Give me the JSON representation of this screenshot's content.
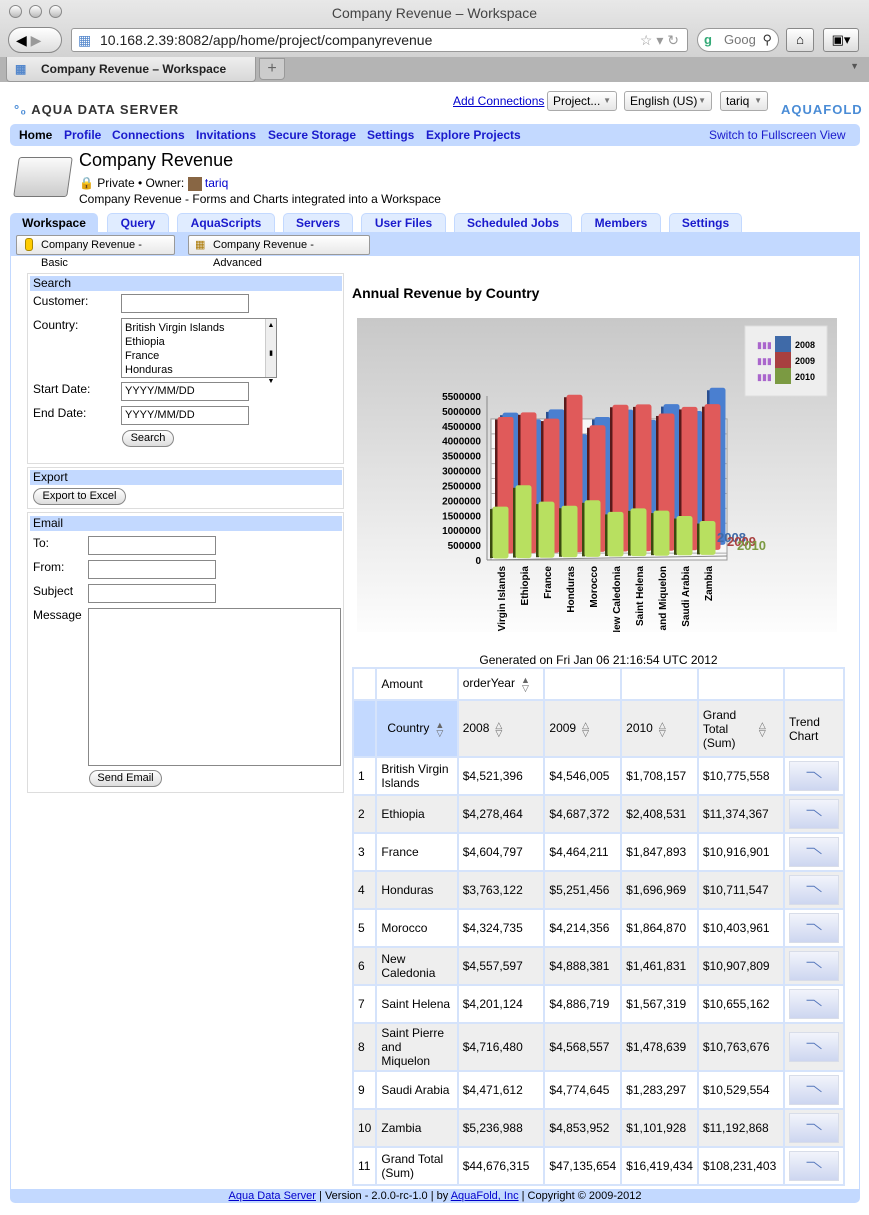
{
  "browser": {
    "window_title": "Company Revenue – Workspace",
    "url": "10.168.2.39:8082/app/home/project/companyrevenue",
    "search_placeholder": "Goog",
    "tab_title": "Company Revenue – Workspace",
    "new_tab": "+"
  },
  "header": {
    "logo_left": "AQUA DATA SERVER",
    "logo_right": "AQUAFOLD",
    "add_connections": "Add Connections",
    "project_select": "Project...",
    "language_select": "English (US)",
    "user_select": "tariq"
  },
  "nav": {
    "items": [
      "Home",
      "Profile",
      "Connections",
      "Invitations",
      "Secure Storage",
      "Settings",
      "Explore Projects"
    ],
    "fullscreen": "Switch to Fullscreen View"
  },
  "project": {
    "title": "Company Revenue",
    "visibility": "Private •",
    "owner_label": "Owner:",
    "owner": "tariq",
    "description": "Company Revenue - Forms and Charts integrated into a Workspace"
  },
  "tabs": [
    "Workspace",
    "Query",
    "AquaScripts",
    "Servers",
    "User Files",
    "Scheduled Jobs",
    "Members",
    "Settings"
  ],
  "subtabs": [
    "Company Revenue - Basic",
    "Company Revenue - Advanced"
  ],
  "search": {
    "title": "Search",
    "customer_label": "Customer:",
    "customer_value": "",
    "country_label": "Country:",
    "countries": [
      "British Virgin Islands",
      "Ethiopia",
      "France",
      "Honduras"
    ],
    "start_label": "Start Date:",
    "start_placeholder": "YYYY/MM/DD",
    "end_label": "End Date:",
    "end_placeholder": "YYYY/MM/DD",
    "button": "Search"
  },
  "export": {
    "title": "Export",
    "button": "Export to Excel"
  },
  "email": {
    "title": "Email",
    "to_label": "To:",
    "from_label": "From:",
    "subject_label": "Subject",
    "message_label": "Message",
    "button": "Send Email"
  },
  "chart_title": "Annual Revenue by Country",
  "chart_data": {
    "type": "bar",
    "title": "Annual Revenue by Country",
    "categories": [
      "Virgin Islands",
      "Ethiopia",
      "France",
      "Honduras",
      "Morocco",
      "New Caledonia",
      "Saint Helena",
      "re and Miquelon",
      "Saudi Arabia",
      "Zambia"
    ],
    "series": [
      {
        "name": "2008",
        "color": "#3f6aa8",
        "values": [
          4521396,
          4278464,
          4604797,
          3763122,
          4324735,
          4557597,
          4201124,
          4716480,
          4471612,
          5236988
        ]
      },
      {
        "name": "2009",
        "color": "#a84040",
        "values": [
          4546005,
          4687372,
          4464211,
          5251456,
          4214356,
          4888381,
          4886719,
          4568557,
          4774645,
          4853952
        ]
      },
      {
        "name": "2010",
        "color": "#7b9a42",
        "values": [
          1708157,
          2408531,
          1847893,
          1696969,
          1864870,
          1461831,
          1567319,
          1478639,
          1283297,
          1101928
        ]
      }
    ],
    "yticks": [
      "0",
      "500000",
      "1000000",
      "1500000",
      "2000000",
      "2500000",
      "3000000",
      "3500000",
      "4000000",
      "4500000",
      "5000000",
      "5500000"
    ],
    "ylim": [
      0,
      5500000
    ],
    "grid": true,
    "legend": "top-right"
  },
  "generated": "Generated on Fri Jan 06 21:16:54 UTC 2012",
  "pivot": {
    "amount": "Amount",
    "order_year": "orderYear",
    "country": "Country",
    "cols": [
      "2008",
      "2009",
      "2010",
      "Grand Total (Sum)"
    ],
    "trend": "Trend Chart",
    "rows": [
      [
        "1",
        "British Virgin Islands",
        "$4,521,396",
        "$4,546,005",
        "$1,708,157",
        "$10,775,558"
      ],
      [
        "2",
        "Ethiopia",
        "$4,278,464",
        "$4,687,372",
        "$2,408,531",
        "$11,374,367"
      ],
      [
        "3",
        "France",
        "$4,604,797",
        "$4,464,211",
        "$1,847,893",
        "$10,916,901"
      ],
      [
        "4",
        "Honduras",
        "$3,763,122",
        "$5,251,456",
        "$1,696,969",
        "$10,711,547"
      ],
      [
        "5",
        "Morocco",
        "$4,324,735",
        "$4,214,356",
        "$1,864,870",
        "$10,403,961"
      ],
      [
        "6",
        "New Caledonia",
        "$4,557,597",
        "$4,888,381",
        "$1,461,831",
        "$10,907,809"
      ],
      [
        "7",
        "Saint Helena",
        "$4,201,124",
        "$4,886,719",
        "$1,567,319",
        "$10,655,162"
      ],
      [
        "8",
        "Saint Pierre and Miquelon",
        "$4,716,480",
        "$4,568,557",
        "$1,478,639",
        "$10,763,676"
      ],
      [
        "9",
        "Saudi Arabia",
        "$4,471,612",
        "$4,774,645",
        "$1,283,297",
        "$10,529,554"
      ],
      [
        "10",
        "Zambia",
        "$5,236,988",
        "$4,853,952",
        "$1,101,928",
        "$11,192,868"
      ],
      [
        "11",
        "Grand Total (Sum)",
        "$44,676,315",
        "$47,135,654",
        "$16,419,434",
        "$108,231,403"
      ]
    ]
  },
  "footer": {
    "product": "Aqua Data Server",
    "version": "| Version - 2.0.0-rc-1.0 | by",
    "company": "AquaFold, Inc",
    "copyright": "| Copyright © 2009-2012"
  }
}
